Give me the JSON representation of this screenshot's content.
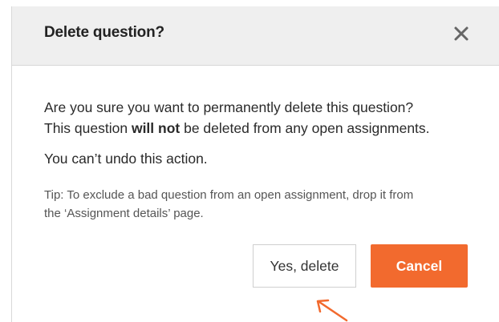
{
  "dialog": {
    "title": "Delete question?",
    "close_icon": "close-icon",
    "message_line1": "Are you sure you want to permanently delete this question?",
    "message_line2_before": "This question ",
    "message_line2_bold": "will not",
    "message_line2_after": " be deleted from any open assignments.",
    "undo_warning": "You can’t undo this action.",
    "tip_line1": "Tip: To exclude a bad question from an open assignment, drop it from",
    "tip_line2": "the ‘Assignment details’ page.",
    "confirm_label": "Yes, delete",
    "cancel_label": "Cancel"
  },
  "colors": {
    "accent": "#f26a2e",
    "header_bg": "#efefef",
    "arrow": "#f26a2e"
  },
  "annotation": {
    "arrow_icon": "arrow-up-left-icon"
  }
}
